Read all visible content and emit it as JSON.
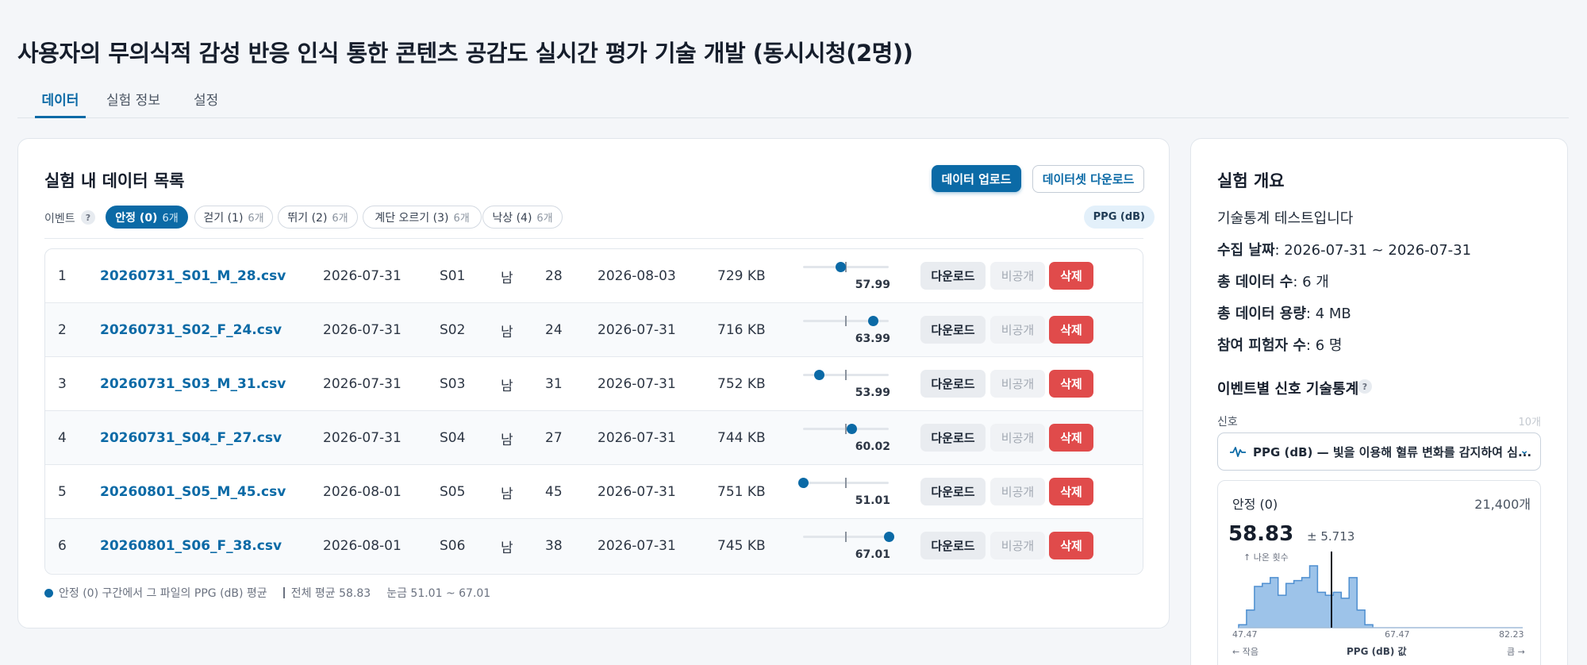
{
  "page": {
    "title": "사용자의 무의식적 감성 반응 인식 통한 콘텐츠 공감도 실시간 평가 기술 개발 (동시시청(2명))"
  },
  "tabs": [
    "데이터",
    "실험 정보",
    "설정"
  ],
  "data_list": {
    "title": "실험 내 데이터 목록",
    "upload_label": "데이터 업로드",
    "dataset_download_label": "데이터셋 다운로드",
    "event_label": "이벤트",
    "help": "?",
    "events": [
      {
        "label": "안정 (0)",
        "count": "6개"
      },
      {
        "label": "걷기 (1)",
        "count": "6개"
      },
      {
        "label": "뛰기 (2)",
        "count": "6개"
      },
      {
        "label": "계단 오르기 (3)",
        "count": "6개"
      },
      {
        "label": "낙상 (4)",
        "count": "6개"
      }
    ],
    "signal_badge": "PPG (dB)",
    "rows": [
      {
        "index": "1",
        "file": "20260731_S01_M_28.csv",
        "date": "2026-07-31",
        "subject": "S01",
        "sex": "남",
        "age": "28",
        "uploaded": "2026-08-03",
        "size": "729 KB",
        "value": 57.99,
        "value_label": "57.99"
      },
      {
        "index": "2",
        "file": "20260731_S02_F_24.csv",
        "date": "2026-07-31",
        "subject": "S02",
        "sex": "남",
        "age": "24",
        "uploaded": "2026-07-31",
        "size": "716 KB",
        "value": 63.99,
        "value_label": "63.99"
      },
      {
        "index": "3",
        "file": "20260731_S03_M_31.csv",
        "date": "2026-07-31",
        "subject": "S03",
        "sex": "남",
        "age": "31",
        "uploaded": "2026-07-31",
        "size": "752 KB",
        "value": 53.99,
        "value_label": "53.99"
      },
      {
        "index": "4",
        "file": "20260731_S04_F_27.csv",
        "date": "2026-07-31",
        "subject": "S04",
        "sex": "남",
        "age": "27",
        "uploaded": "2026-07-31",
        "size": "744 KB",
        "value": 60.02,
        "value_label": "60.02"
      },
      {
        "index": "5",
        "file": "20260801_S05_M_45.csv",
        "date": "2026-08-01",
        "subject": "S05",
        "sex": "남",
        "age": "45",
        "uploaded": "2026-07-31",
        "size": "751 KB",
        "value": 51.01,
        "value_label": "51.01"
      },
      {
        "index": "6",
        "file": "20260801_S06_F_38.csv",
        "date": "2026-08-01",
        "subject": "S06",
        "sex": "남",
        "age": "38",
        "uploaded": "2026-07-31",
        "size": "745 KB",
        "value": 67.01,
        "value_label": "67.01"
      }
    ],
    "row_actions": {
      "download": "다운로드",
      "private": "비공개",
      "delete": "삭제"
    },
    "scale_min": 51.01,
    "scale_max": 67.01,
    "overall_mean": 58.83,
    "legend": {
      "dot_text": "안정 (0) 구간에서 그 파일의 PPG (dB) 평균",
      "mean_text": "전체 평균 58.83",
      "range_text": "눈금 51.01 ~ 67.01"
    }
  },
  "overview": {
    "title": "실험 개요",
    "description": "기술통계 테스트입니다",
    "fields": [
      {
        "label": "수집 날짜",
        "value": ": 2026-07-31 ~ 2026-07-31"
      },
      {
        "label": "총 데이터 수",
        "value": ": 6 개"
      },
      {
        "label": "총 데이터 용량",
        "value": ": 4 MB"
      },
      {
        "label": "참여 피험자 수",
        "value": ": 6 명"
      }
    ],
    "stats_title": "이벤트별 신호 기술통계",
    "signal_label": "신호",
    "signal_count": "10개",
    "signal_select": "PPG (dB) — 빛을 이용해 혈류 변화를 감지하여 심...",
    "stat": {
      "event": "안정 (0)",
      "count": "21,400개",
      "mean": "58.83",
      "sd": "± 5.713",
      "y_hint": "↑ 나온 횟수",
      "x_min_label": "47.47",
      "x_mid_label": "67.47",
      "x_max_label": "82.23",
      "left_hint": "← 작음",
      "x_title": "PPG (dB) 값",
      "right_hint": "큼 →"
    }
  },
  "chart_data": {
    "type": "bar",
    "title": "",
    "xlabel": "PPG (dB) 값",
    "ylabel": "나온 횟수",
    "xlim": [
      47.47,
      82.23
    ],
    "mean": 58.83,
    "values": [
      1,
      6,
      14,
      15,
      17,
      11,
      15,
      16,
      17,
      21,
      12,
      11,
      12,
      10,
      17,
      6,
      1,
      0,
      0,
      0,
      0,
      0,
      0,
      0,
      0,
      0,
      0,
      0,
      0,
      0,
      0,
      0,
      0,
      0,
      0,
      0
    ],
    "grid": false,
    "legend": "none"
  },
  "colors": {
    "accent": "#0b6aa6",
    "danger": "#e04b4b",
    "bar": "#9dc3e9",
    "bar_stroke": "#4f8fd0"
  },
  "icons": {
    "signal_select_icon": "pulse-icon",
    "chevron": "chevron-down-icon"
  }
}
